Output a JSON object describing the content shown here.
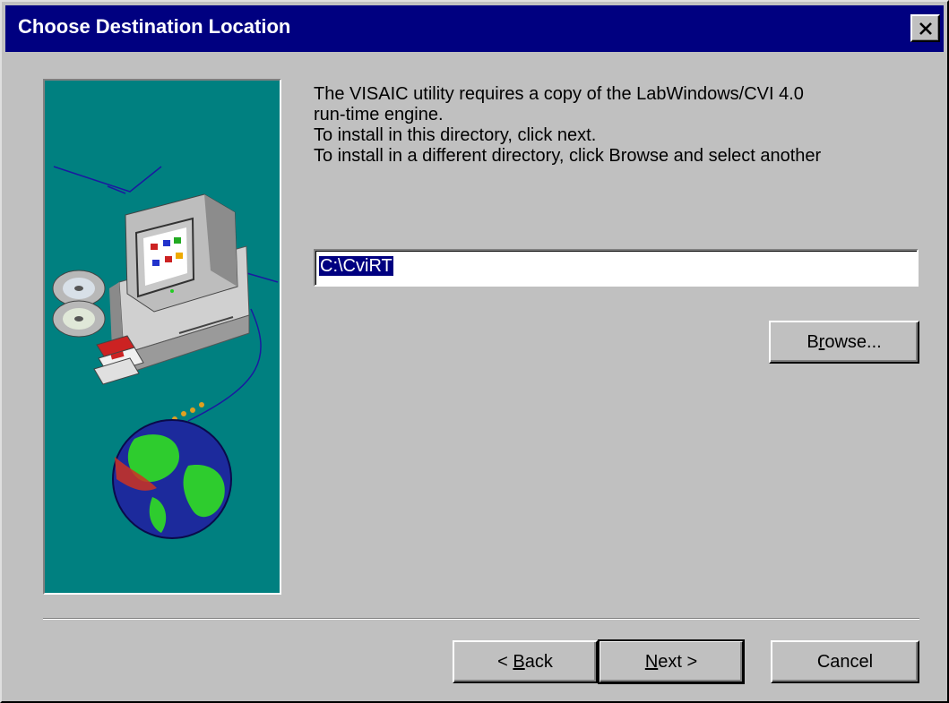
{
  "window": {
    "title": "Choose Destination Location"
  },
  "description": {
    "lines": [
      "The VISAIC utility requires a copy of the LabWindows/CVI 4.0",
      "run-time engine.",
      "To install in this directory, click next.",
      "To install in a different directory, click Browse and select another"
    ]
  },
  "path_field": {
    "value": "C:\\CviRT"
  },
  "buttons": {
    "browse_pre": "B",
    "browse_key": "r",
    "browse_post": "owse...",
    "back_pre": "< ",
    "back_key": "B",
    "back_post": "ack",
    "next_key": "N",
    "next_post": "ext >",
    "cancel": "Cancel"
  },
  "colors": {
    "titlebar": "#000080",
    "face": "#c0c0c0",
    "illustration_bg": "#008080",
    "selection": "#000080"
  },
  "icons": [
    "close-icon",
    "computer-icon",
    "cd-icon",
    "floppy-icon",
    "globe-icon"
  ]
}
